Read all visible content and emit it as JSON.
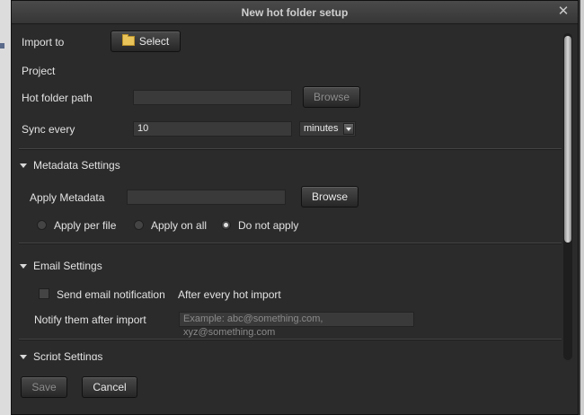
{
  "dialog": {
    "title": "New hot folder setup"
  },
  "general": {
    "import_to_label": "Import to",
    "select_button": "Select",
    "project_label": "Project",
    "hot_folder_label": "Hot folder path",
    "hot_folder_value": "",
    "browse_button": "Browse",
    "sync_label": "Sync every",
    "sync_value": "10",
    "sync_unit": "minutes"
  },
  "metadata": {
    "header": "Metadata Settings",
    "apply_label": "Apply Metadata",
    "apply_value": "",
    "browse_button": "Browse",
    "options": [
      "Apply per file",
      "Apply on all",
      "Do not apply"
    ],
    "selected": "Do not apply"
  },
  "email": {
    "header": "Email Settings",
    "send_label": "Send email notification",
    "send_checked": false,
    "after_label": "After every hot import",
    "notify_label": "Notify them after import",
    "notify_placeholder": "Example: abc@something.com, xyz@something.com"
  },
  "script": {
    "header": "Script Settings"
  },
  "footer": {
    "save_button": "Save",
    "cancel_button": "Cancel",
    "save_enabled": false
  },
  "scrollbar": {
    "position_fraction": 0.0,
    "visible_fraction": 0.62
  },
  "colors": {
    "background": "#2b2b2b",
    "titlebar": "#3f3f3f",
    "text": "#e6e6e6",
    "disabled_text": "#8c8c8c"
  }
}
